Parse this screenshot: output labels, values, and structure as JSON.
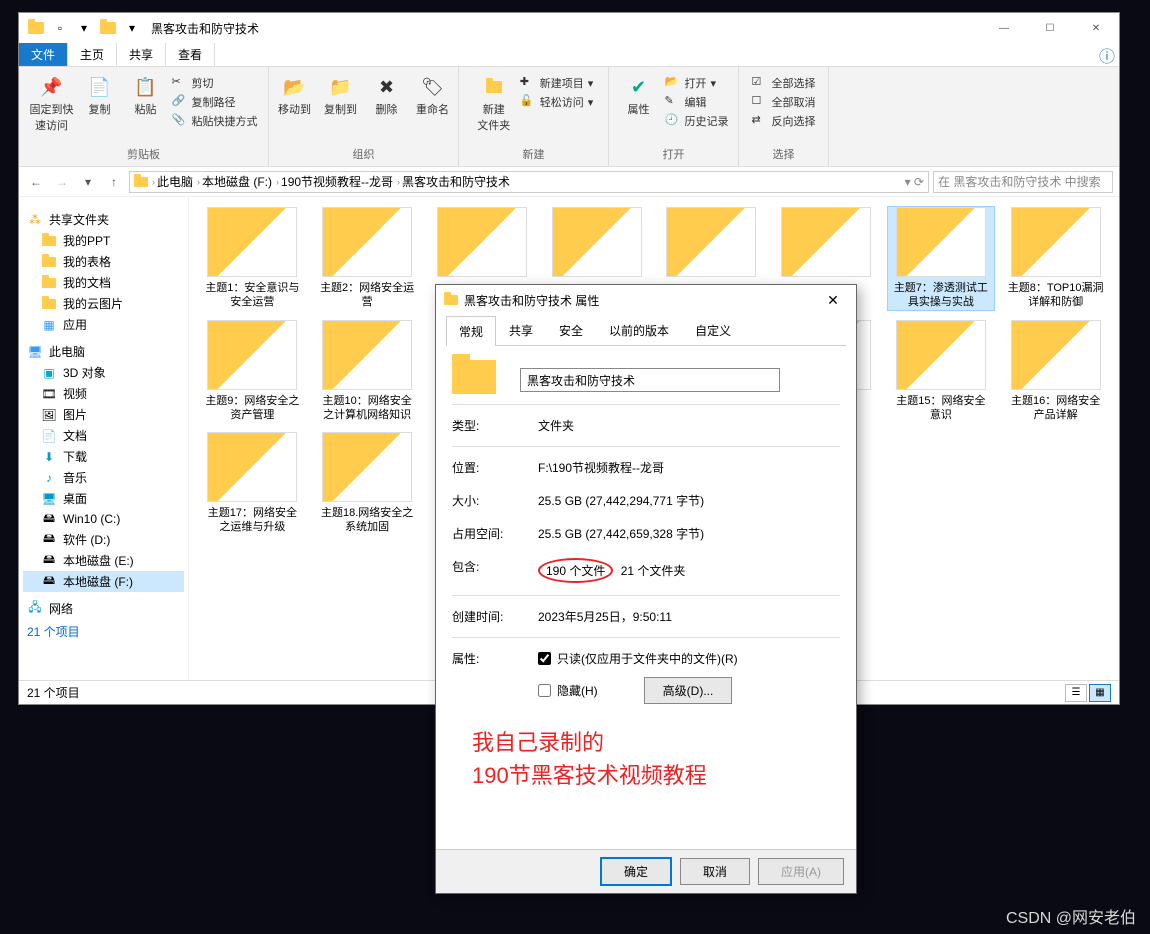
{
  "titlebar": {
    "title": "黑客攻击和防守技术"
  },
  "win_controls": {
    "min": "—",
    "max": "☐",
    "close": "✕"
  },
  "menubar": {
    "file": "文件",
    "home": "主页",
    "share": "共享",
    "view": "查看",
    "help": "?"
  },
  "ribbon": {
    "g1": {
      "pin": "固定到快\n速访问",
      "copy": "复制",
      "paste": "粘贴",
      "cut": "剪切",
      "copy_path": "复制路径",
      "paste_shortcut": "粘贴快捷方式",
      "title": "剪贴板"
    },
    "g2": {
      "move_to": "移动到",
      "copy_to": "复制到",
      "delete": "删除",
      "rename": "重命名",
      "title": "组织"
    },
    "g3": {
      "new_folder": "新建\n文件夹",
      "new_item": "新建项目",
      "easy_access": "轻松访问",
      "title": "新建"
    },
    "g4": {
      "properties": "属性",
      "open": "打开",
      "edit": "编辑",
      "history": "历史记录",
      "title": "打开"
    },
    "g5": {
      "select_all": "全部选择",
      "select_none": "全部取消",
      "invert": "反向选择",
      "title": "选择"
    }
  },
  "nav": {
    "breadcrumb": [
      "此电脑",
      "本地磁盘 (F:)",
      "190节视频教程--龙哥",
      "黑客攻击和防守技术"
    ],
    "search_placeholder": "在 黑客攻击和防守技术 中搜索"
  },
  "sidebar": {
    "shared": "共享文件夹",
    "items1": [
      "我的PPT",
      "我的表格",
      "我的文档",
      "我的云图片",
      "应用"
    ],
    "thispc": "此电脑",
    "items2": [
      "3D 对象",
      "视频",
      "图片",
      "文档",
      "下载",
      "音乐",
      "桌面",
      "Win10 (C:)",
      "软件 (D:)",
      "本地磁盘 (E:)",
      "本地磁盘 (F:)"
    ],
    "network": "网络",
    "count": "21 个项目"
  },
  "grid": [
    "主题1：安全意识与安全运营",
    "主题2：网络安全运营",
    "",
    "",
    "",
    "",
    "主题7：渗透测试工具实操与实战",
    "主题8：TOP10漏洞详解和防御",
    "主题9：网络安全之资产管理",
    "主题10：网络安全之计算机网络知识",
    "",
    "",
    "",
    "",
    "主题15：网络安全意识",
    "主题16：网络安全产品详解",
    "主题17：网络安全之运维与升级",
    "主题18.网络安全之系统加固"
  ],
  "dialog": {
    "title": "黑客攻击和防守技术 属性",
    "tabs": [
      "常规",
      "共享",
      "安全",
      "以前的版本",
      "自定义"
    ],
    "name": "黑客攻击和防守技术",
    "type_l": "类型:",
    "type_v": "文件夹",
    "loc_l": "位置:",
    "loc_v": "F:\\190节视频教程--龙哥",
    "size_l": "大小:",
    "size_v": "25.5 GB (27,442,294,771 字节)",
    "disk_l": "占用空间:",
    "disk_v": "25.5 GB (27,442,659,328 字节)",
    "contains_l": "包含:",
    "contains_files": "190 个文件",
    "contains_folders": "21 个文件夹",
    "created_l": "创建时间:",
    "created_v": "2023年5月25日，9:50:11",
    "attr_l": "属性:",
    "readonly": "只读(仅应用于文件夹中的文件)(R)",
    "hidden": "隐藏(H)",
    "advanced": "高级(D)...",
    "annotation1": "我自己录制的",
    "annotation2": "190节黑客技术视频教程",
    "ok": "确定",
    "cancel": "取消",
    "apply": "应用(A)"
  },
  "watermark": "CSDN @网安老伯"
}
